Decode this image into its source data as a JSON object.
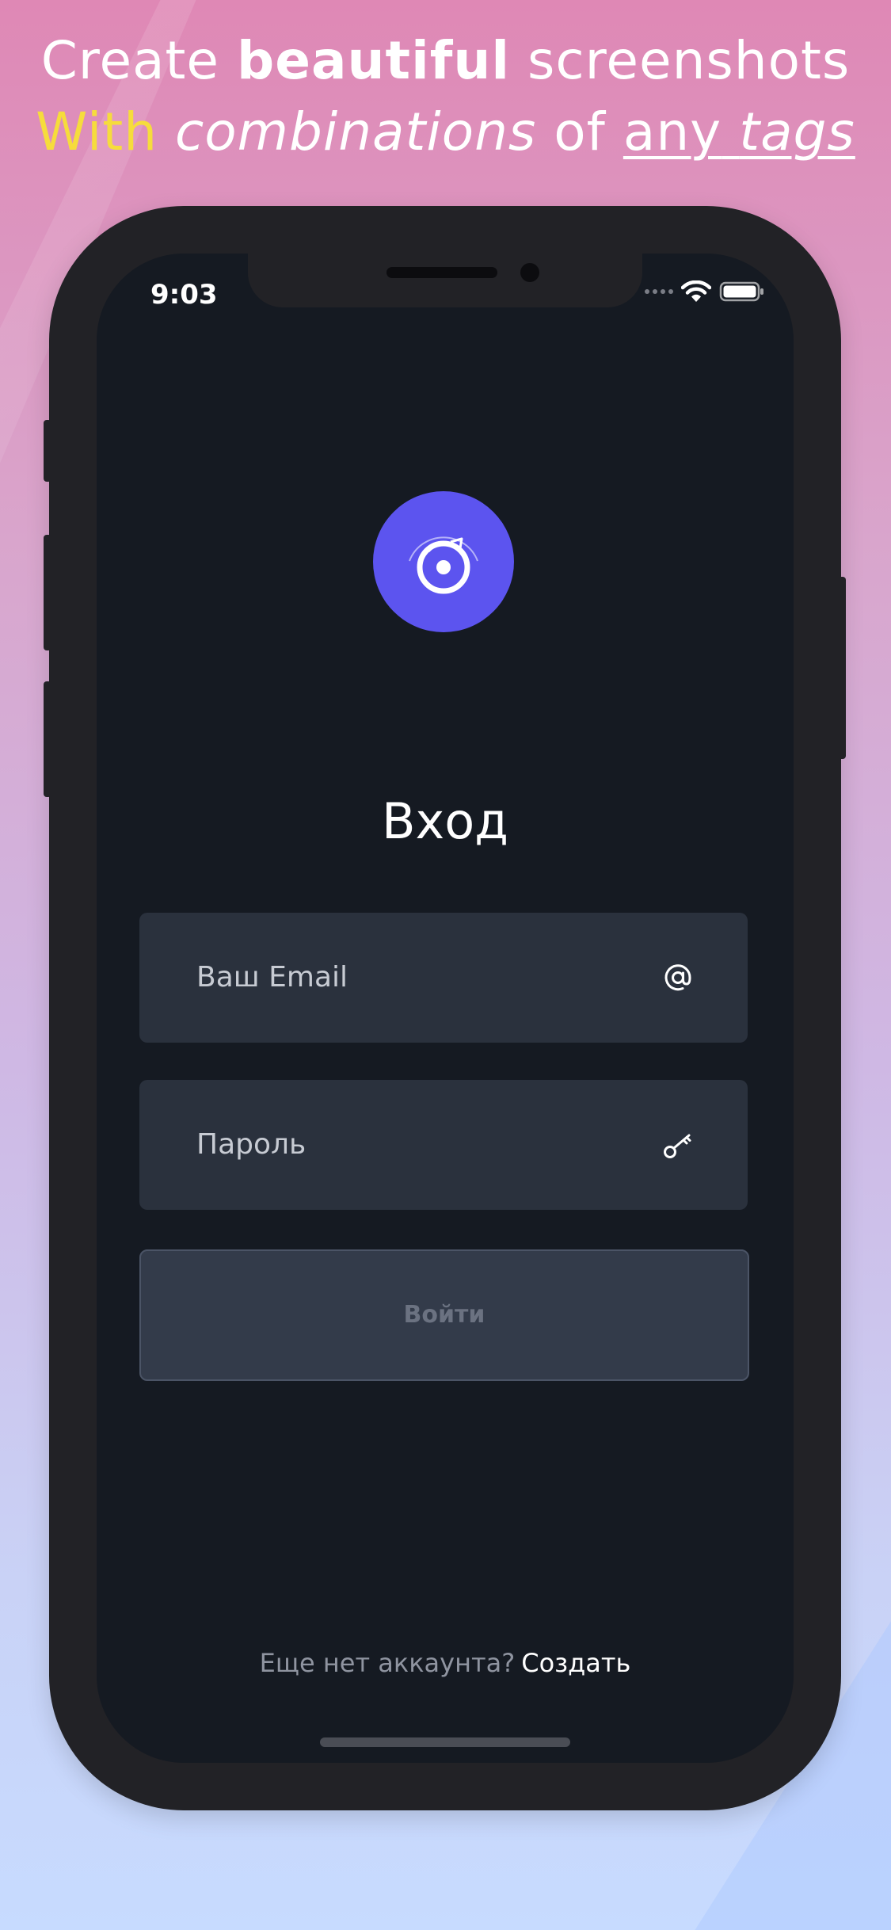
{
  "headline": {
    "line1_part1": "Create ",
    "line1_bold": "beautiful",
    "line1_part2": " screenshots",
    "line2_yellow": "With",
    "line2_italic": "combinations",
    "line2_of": " of ",
    "line2_any": "any",
    "line2_tags": "tags"
  },
  "colors": {
    "accent": "#5c54ef",
    "highlight": "#f6dc3c",
    "screen_bg": "#151a22",
    "field_bg": "#2a313d"
  },
  "status_bar": {
    "time": "9:03",
    "icons": [
      "signal-dots-icon",
      "wifi-icon",
      "battery-icon"
    ]
  },
  "login": {
    "title": "Вход",
    "email_placeholder": "Ваш Email",
    "email_icon": "at-sign-icon",
    "password_placeholder": "Пароль",
    "password_icon": "key-icon",
    "submit_label": "Войти"
  },
  "footer": {
    "question": "Еще нет аккаунта?",
    "create_link": "Создать"
  }
}
